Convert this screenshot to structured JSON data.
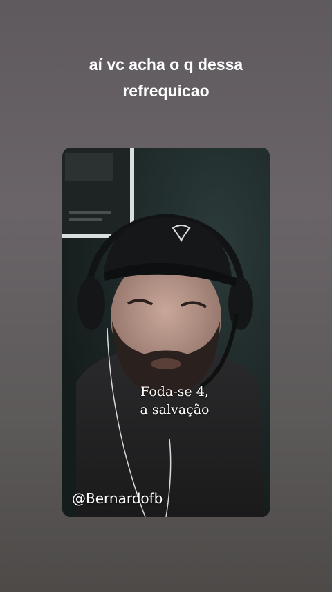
{
  "story": {
    "caption_line1": "aí vc acha o q dessa",
    "caption_line2": "refrequicao"
  },
  "video": {
    "subtitle_line1": "Foda-se 4,",
    "subtitle_line2": "a salvação",
    "watermark": "@Bernardofb"
  },
  "colors": {
    "background_top": "#5f5a5e",
    "background_bottom": "#4d4a48",
    "caption_text": "#ffffff",
    "video_bg": "#1b2323"
  }
}
